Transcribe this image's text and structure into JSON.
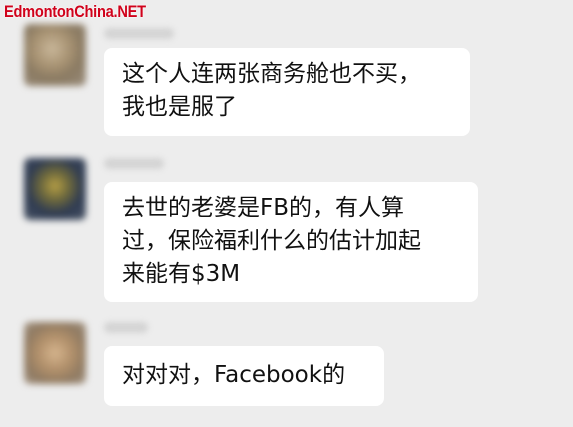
{
  "watermark": "EdmontonChina.NET",
  "messages": [
    {
      "lines": [
        "这个人连两张商务舱也不买，",
        "我也是服了"
      ]
    },
    {
      "lines": [
        "去世的老婆是FB的，有人算",
        "过，保险福利什么的估计加起",
        "来能有$3M"
      ]
    },
    {
      "lines": [
        "对对对，Facebook的"
      ]
    }
  ]
}
